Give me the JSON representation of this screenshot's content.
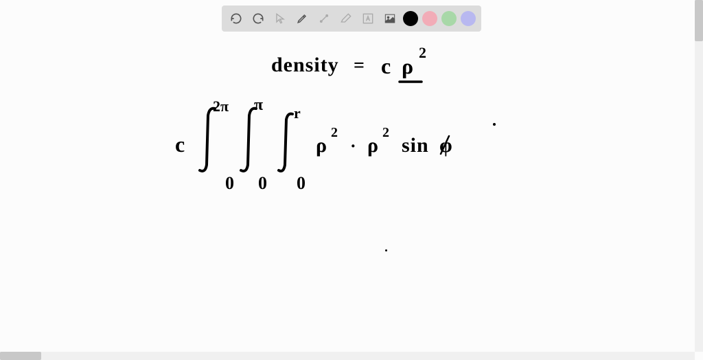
{
  "toolbar": {
    "tools": {
      "undo": "undo",
      "redo": "redo",
      "pointer": "pointer",
      "pen": "pen",
      "config": "config",
      "eraser": "eraser",
      "text": "text",
      "image": "image"
    },
    "colors": {
      "black": "#000000",
      "pink": "#f2acb7",
      "green": "#a8d8a8",
      "purple": "#b8b8f0"
    }
  },
  "hand": {
    "line1_left": "density",
    "line1_eq": "=",
    "line1_c": "c",
    "line1_rho": "ρ",
    "line1_exp": "2",
    "c_prefix": "c",
    "limit_2pi": "2π",
    "limit_pi": "π",
    "limit_r": "r",
    "limit_zero": "0",
    "rho": "ρ",
    "exp2": "2",
    "dot": "·",
    "sin": "sin",
    "phi": "φ"
  }
}
